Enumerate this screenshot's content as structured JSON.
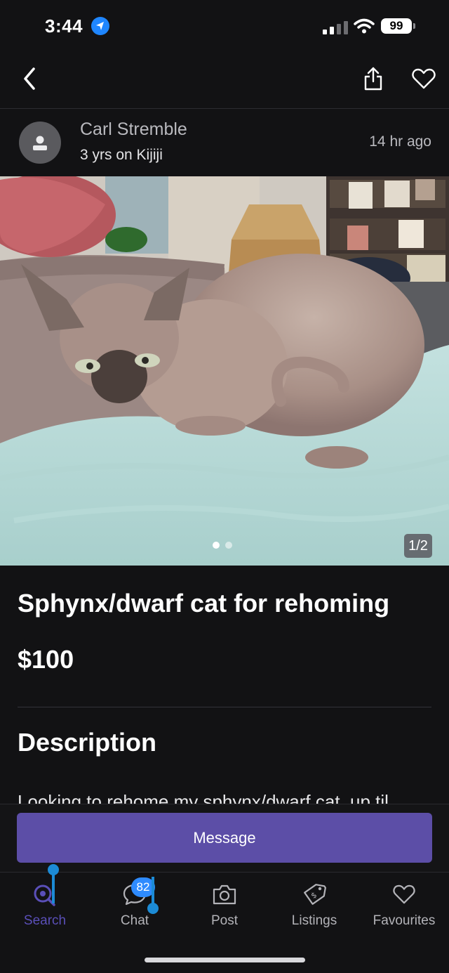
{
  "status_bar": {
    "time": "3:44",
    "battery": "99",
    "icons": [
      "location-arrow-icon",
      "signal-icon",
      "wifi-icon",
      "battery-icon"
    ]
  },
  "nav": {
    "icons": [
      "chevron-left-icon",
      "share-icon",
      "heart-icon"
    ]
  },
  "seller": {
    "name": "Carl Stremble",
    "tenure": "3 yrs on Kijiji",
    "posted": "14 hr  ago",
    "avatar_icon": "user-icon"
  },
  "gallery": {
    "counter": "1/2",
    "current_page": 1,
    "total_pages": 2
  },
  "listing": {
    "title": "Sphynx/dwarf cat for rehoming",
    "price": "$100",
    "description_heading": "Description",
    "description_preview": "Looking to rehome my sphynx/dwarf cat, up til"
  },
  "message_button": "Message",
  "tabs": [
    {
      "label": "Search",
      "icon": "search-icon",
      "active": true
    },
    {
      "label": "Chat",
      "icon": "chat-icon",
      "badge": "82"
    },
    {
      "label": "Post",
      "icon": "camera-icon"
    },
    {
      "label": "Listings",
      "icon": "price-tag-icon"
    },
    {
      "label": "Favourites",
      "icon": "heart-icon"
    }
  ],
  "colors": {
    "background": "#121214",
    "accent": "#5c4ea7",
    "active_tab": "#5a4fb8",
    "badge": "#2e8bff",
    "location": "#1f86ff"
  }
}
